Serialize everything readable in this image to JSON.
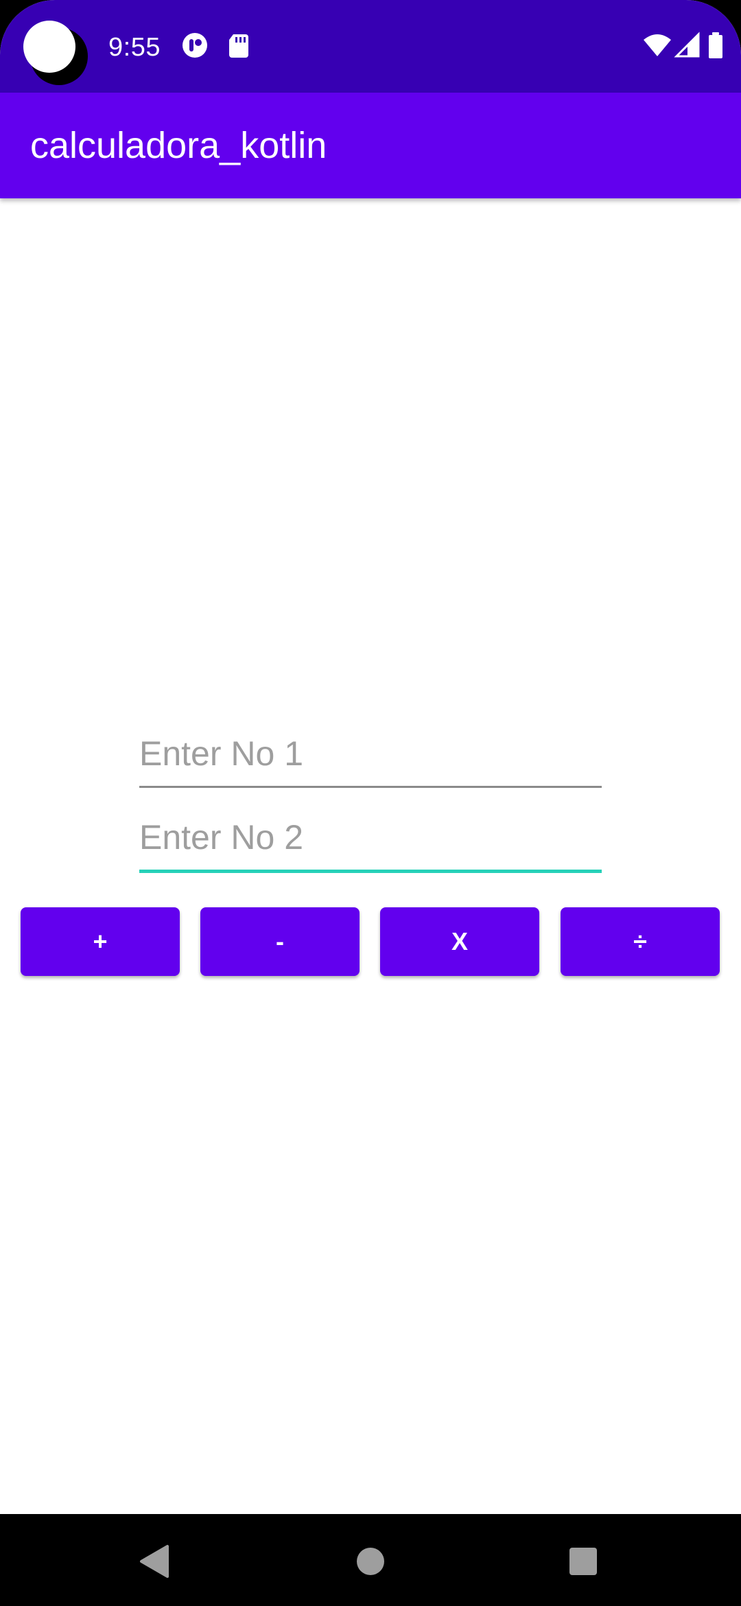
{
  "status_bar": {
    "time": "9:55",
    "icons": {
      "left": [
        "notification-app-icon",
        "sd-card-icon"
      ],
      "right": [
        "wifi-icon",
        "signal-icon",
        "battery-icon"
      ]
    },
    "background": "#3700B3"
  },
  "app_bar": {
    "title": "calculadora_kotlin",
    "background": "#6200EE"
  },
  "form": {
    "number1": {
      "value": "",
      "placeholder": "Enter No 1"
    },
    "number2": {
      "value": "",
      "placeholder": "Enter No 2"
    },
    "focus_color": "#26D1B8"
  },
  "operations": {
    "add_label": "+",
    "subtract_label": "-",
    "multiply_label": "X",
    "divide_label": "÷",
    "button_color": "#6200EE"
  },
  "nav_bar": {
    "icons": [
      "back-icon",
      "home-icon",
      "recents-icon"
    ]
  }
}
